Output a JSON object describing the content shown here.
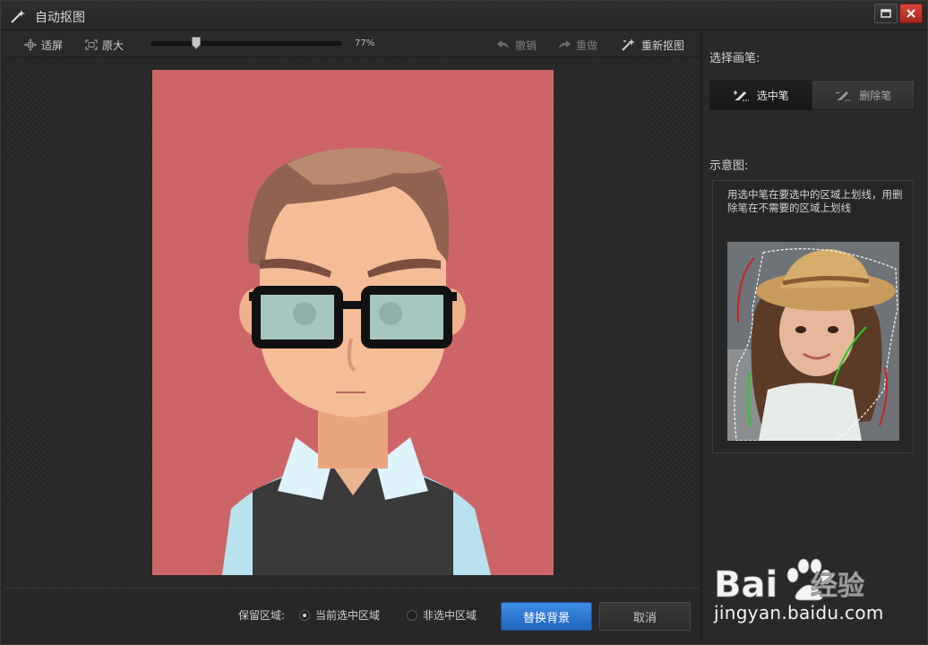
{
  "window": {
    "title": "自动抠图",
    "maximize_icon": "maximize-icon",
    "close_icon": "close-icon"
  },
  "toolbar": {
    "fit_label": "适屏",
    "original_label": "原大",
    "zoom_percent": "77%",
    "zoom_value": 0.77,
    "undo_label": "撤销",
    "redo_label": "重做",
    "recut_label": "重新抠图"
  },
  "bottom": {
    "keep_area_label": "保留区域:",
    "option_selected": "当前选中区域",
    "option_unselected": "非选中区域",
    "selected_option_index": 0,
    "replace_bg_button": "替换背景",
    "cancel_button": "取消"
  },
  "panel": {
    "choose_brush_label": "选择画笔:",
    "select_brush": "选中笔",
    "delete_brush": "删除笔",
    "active_brush": "select",
    "demo_label": "示意图:",
    "demo_text": "用选中笔在要选中的区域上划线，用删除笔在不需要的区域上划线"
  },
  "watermark": {
    "brand": "Bai 经验",
    "url": "jingyan.baidu.com"
  },
  "colors": {
    "photo_background": "#cd6568",
    "primary_button": "#2a73d0",
    "close_button": "#c0342b",
    "select_stroke": "#22cc22",
    "delete_stroke": "#cc2222"
  }
}
